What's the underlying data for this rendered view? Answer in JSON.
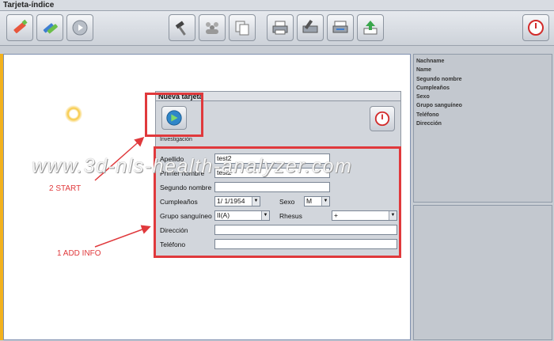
{
  "window": {
    "title": "Tarjeta-índice"
  },
  "toolbar": {
    "buttons": [
      {
        "icon": "pencil-edit-icon"
      },
      {
        "icon": "pencil-group-icon"
      },
      {
        "icon": "play-disc-icon"
      },
      {
        "icon": "hammer-icon"
      },
      {
        "icon": "group-people-icon"
      },
      {
        "icon": "copy-icon"
      },
      {
        "icon": "printer-icon"
      },
      {
        "icon": "print-edit-icon"
      },
      {
        "icon": "print-preview-icon"
      },
      {
        "icon": "export-icon"
      },
      {
        "icon": "power-icon"
      }
    ]
  },
  "info_panel": {
    "labels": [
      "Nachname",
      "Name",
      "Segundo nombre",
      "Cumpleaños",
      "Sexo",
      "Grupo sanguíneo",
      "Teléfono",
      "Dirección"
    ]
  },
  "dialog": {
    "title": "Nueva tarjeta",
    "section_label": "Investigación",
    "fields": {
      "apellido": {
        "label": "Apellido",
        "value": "test2"
      },
      "nombre": {
        "label": "Primer nombre",
        "value": "test2"
      },
      "segundo_nombre": {
        "label": "Segundo nombre",
        "value": ""
      },
      "cumpleanos": {
        "label": "Cumpleaños",
        "value": "1/ 1/1954"
      },
      "sexo": {
        "label": "Sexo",
        "value": "M"
      },
      "grupo_sanguineo": {
        "label": "Grupo sanguíneo",
        "value": "II(A)"
      },
      "rhesus": {
        "label": "Rhesus",
        "value": "+"
      },
      "direccion": {
        "label": "Dirección",
        "value": ""
      },
      "telefono": {
        "label": "Teléfono",
        "value": ""
      }
    }
  },
  "annotations": {
    "step2": "2 START",
    "step1": "1 ADD INFO",
    "color": "#e0393c"
  },
  "watermark": "www.3d-nls-health-analyzer.com"
}
